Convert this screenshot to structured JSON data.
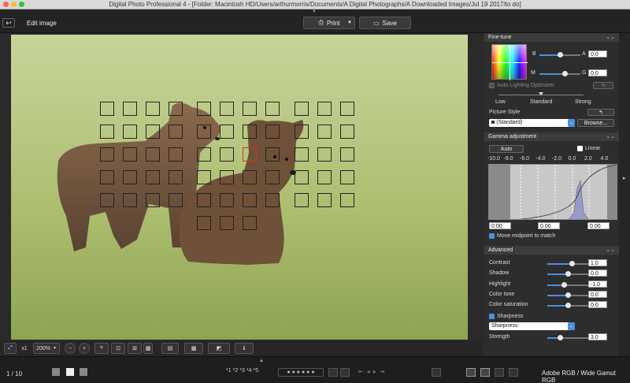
{
  "window": {
    "title": "Digital Photo Professional 4 - [Folder: Macintosh HD/Users/arthurmorris/Documents/A Digital Photographs/A Downloaded Images/Jul 19 2017/to do]"
  },
  "toolbar": {
    "back_icon": "back-arrow-icon",
    "edit_title": "Edit image",
    "print_label": "Print",
    "save_label": "Save"
  },
  "bottom": {
    "zoom_1x": "x1",
    "zoom_value": "200%"
  },
  "status": {
    "counter": "1 / 10",
    "ratings": [
      "*1",
      "*2",
      "*3",
      "*4",
      "*5"
    ],
    "color_profile": "Adobe RGB / Wide Gamut RGB"
  },
  "panel": {
    "finetune": {
      "header": "Fine-tune",
      "b_label": "B",
      "a_label": "A",
      "a_value": "0.0",
      "m_label": "M",
      "g_label": "G",
      "g_value": "0.0",
      "alo_label": "Auto Lighting Optimizer",
      "alo_levels": [
        "Low",
        "Standard",
        "Strong"
      ],
      "alo_value": 0.5,
      "ps_label": "Picture Style",
      "ps_selected": "(Standard)",
      "browse_label": "Browse...",
      "ba_level": 0.5,
      "mg_level": 0.62
    },
    "gamma": {
      "header": "Gamma adjustment",
      "auto_label": "Auto",
      "linear_label": "Linear",
      "scale": [
        "-10.0",
        "-8.0",
        "-6.0",
        "-4.0",
        "-2.0",
        "0.0",
        "2.0",
        "4.0"
      ],
      "values": [
        "0.00",
        "0.00",
        "0.00"
      ],
      "midpoint_label": "Move midpoint to match"
    },
    "advanced": {
      "header": "Advanced",
      "rows": [
        {
          "label": "Contrast",
          "value": "1.0",
          "level": 0.6
        },
        {
          "label": "Shadow",
          "value": "0.0",
          "level": 0.5
        },
        {
          "label": "Highlight",
          "value": "-1.0",
          "level": 0.4
        },
        {
          "label": "Color tone",
          "value": "0.0",
          "level": 0.5
        },
        {
          "label": "Color saturation",
          "value": "0.0",
          "level": 0.5
        }
      ],
      "sharpness_check": "Sharpness",
      "sharpness_select": "Sharpness",
      "strength_label": "Strength",
      "strength_value": "3.0",
      "strength_level": 0.3
    }
  },
  "colors": {
    "accent": "#4a90d9",
    "bg": "#2b2b2b",
    "panel": "#2d2d2d",
    "header": "#3c3c3c"
  }
}
